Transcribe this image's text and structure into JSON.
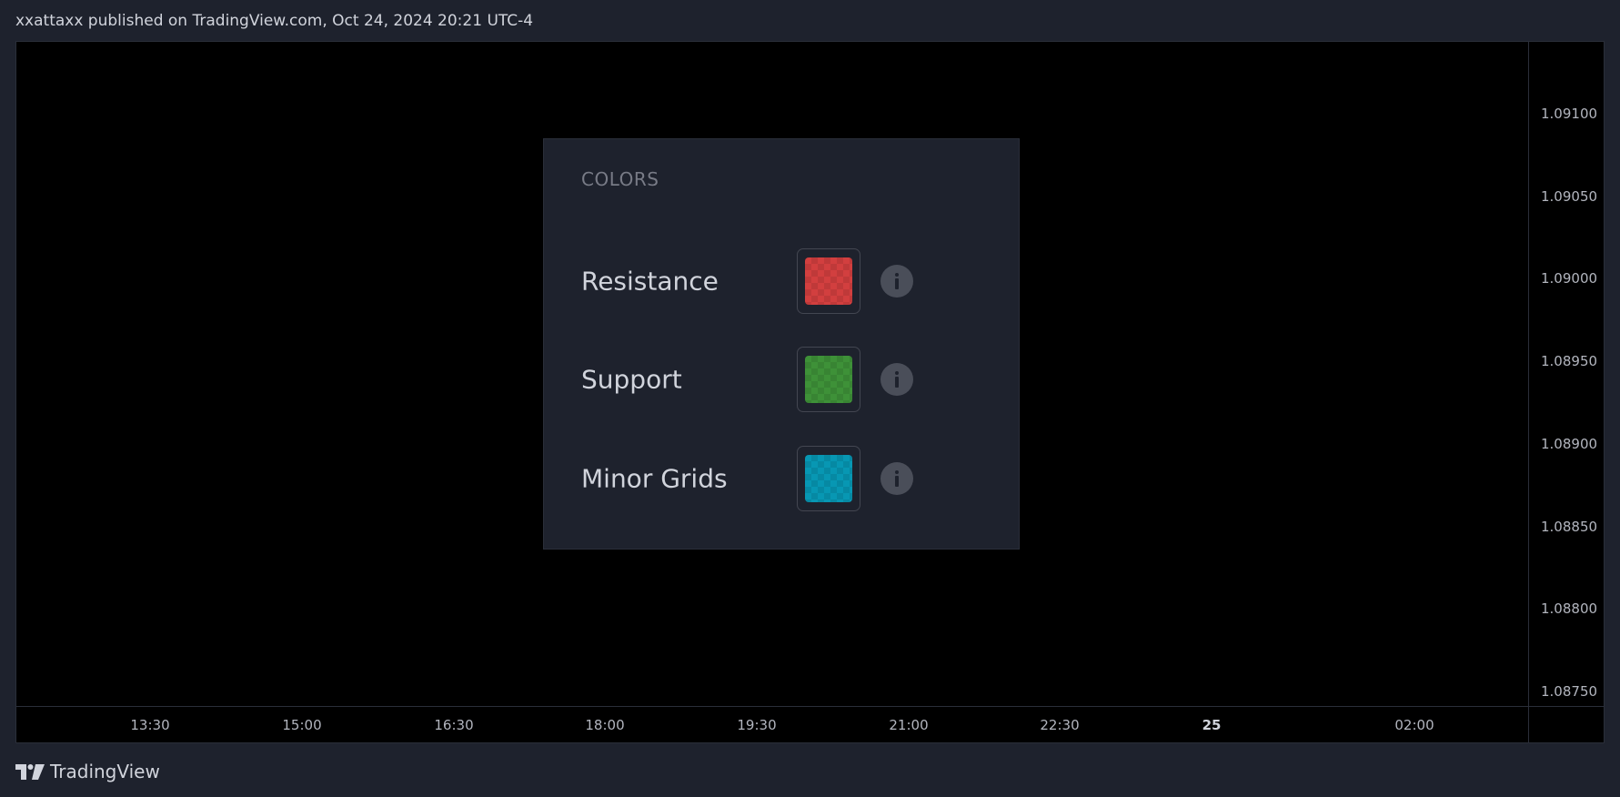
{
  "header": {
    "published_text": "xxattaxx published on TradingView.com, Oct 24, 2024 20:21 UTC-4"
  },
  "price_axis": {
    "labels": [
      "1.09100",
      "1.09050",
      "1.09000",
      "1.08950",
      "1.08900",
      "1.08850",
      "1.08800",
      "1.08750"
    ]
  },
  "time_axis": {
    "labels": [
      "13:30",
      "15:00",
      "16:30",
      "18:00",
      "19:30",
      "21:00",
      "22:30",
      "25",
      "02:00"
    ],
    "bold_label": "25"
  },
  "colors_panel": {
    "title": "COLORS",
    "rows": [
      {
        "label": "Resistance",
        "color": "#d23f3f",
        "icon": "info-icon"
      },
      {
        "label": "Support",
        "color": "#3e9138",
        "icon": "info-icon"
      },
      {
        "label": "Minor Grids",
        "color": "#0797b3",
        "icon": "info-icon"
      }
    ]
  },
  "footer": {
    "brand": "TradingView",
    "logo_icon": "tradingview-logo-icon"
  }
}
